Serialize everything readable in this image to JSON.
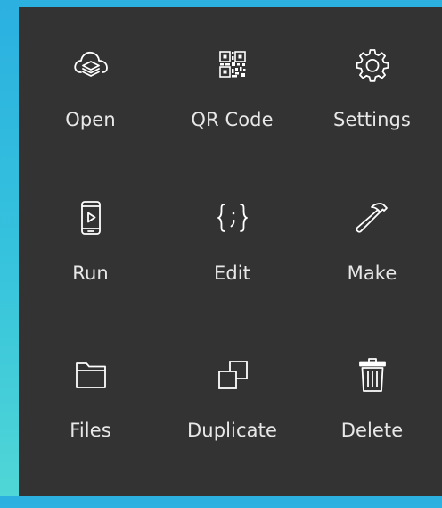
{
  "menu": {
    "items": [
      {
        "label": "Open",
        "icon": "cloud-layers-icon"
      },
      {
        "label": "QR Code",
        "icon": "qr-code-icon"
      },
      {
        "label": "Settings",
        "icon": "gear-icon"
      },
      {
        "label": "Run",
        "icon": "phone-play-icon"
      },
      {
        "label": "Edit",
        "icon": "braces-icon"
      },
      {
        "label": "Make",
        "icon": "hammer-icon"
      },
      {
        "label": "Files",
        "icon": "folder-icon"
      },
      {
        "label": "Duplicate",
        "icon": "duplicate-icon"
      },
      {
        "label": "Delete",
        "icon": "trash-icon"
      }
    ]
  },
  "colors": {
    "background_top": "#2bb0e0",
    "background_bottom": "#4fd6d6",
    "panel": "#333333",
    "text": "#e8e8e8",
    "icon": "#ffffff"
  }
}
